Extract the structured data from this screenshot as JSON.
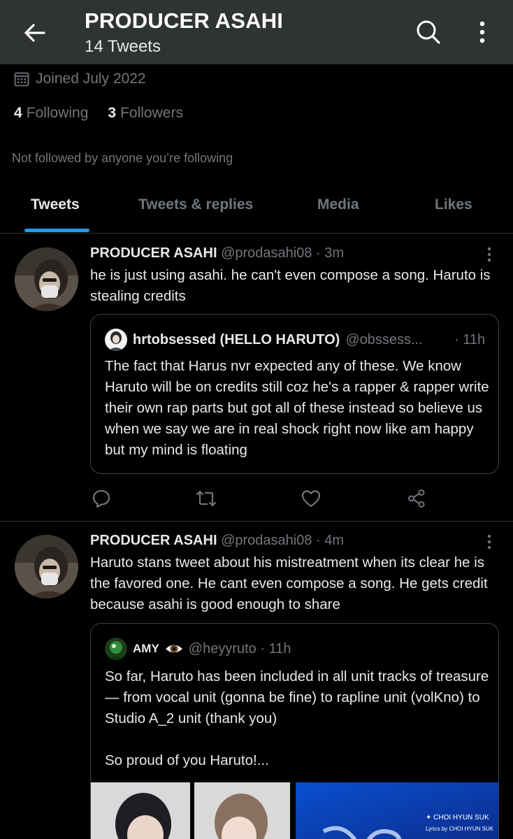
{
  "header": {
    "title": "PRODUCER ASAHI",
    "subtitle": "14 Tweets"
  },
  "profile": {
    "joined": "Joined July 2022",
    "following_count": "4",
    "following_label": "Following",
    "followers_count": "3",
    "followers_label": "Followers",
    "not_followed": "Not followed by anyone you’re following"
  },
  "tabs": [
    {
      "label": "Tweets",
      "active": true
    },
    {
      "label": "Tweets & replies",
      "active": false
    },
    {
      "label": "Media",
      "active": false
    },
    {
      "label": "Likes",
      "active": false
    }
  ],
  "tweets": [
    {
      "name": "PRODUCER ASAHI",
      "meta": "@prodasahi08 · 3m",
      "text": "he is just using asahi. he can't even compose a song. Haruto is stealing credits",
      "quote": {
        "name": "hrtobsessed (HELLO HARUTO)",
        "meta": "@obssess...",
        "time": "· 11h",
        "text": "The fact that Harus nvr expected any of these. We know Haruto will be on credits still coz he's a rapper & rapper write their own rap parts but got all of these instead so believe us when we say we are in real shock right now like am happy but my mind is floating"
      }
    },
    {
      "name": "PRODUCER ASAHI",
      "meta": "@prodasahi08 · 4m",
      "text": "Haruto stans tweet about his mistreatment when its clear he is the favored one. He cant even compose a song. He gets credit because asahi is good enough to share",
      "quote": {
        "name": "AMY",
        "meta": "@heyyruto · 11h",
        "text": "So far, Haruto has been included in all unit tracks of treasure — from vocal unit (gonna be fine) to rapline unit (volKno) to Studio A_2 unit (thank you)\n\nSo proud of you Haruto!...",
        "media_caption_1": "✦ CHOI HYUN SUK",
        "media_caption_2": "Lyrics by CHOI HYUN SUK"
      }
    }
  ],
  "icons": {
    "back": "arrow-left-icon",
    "search": "search-icon",
    "more": "more-vertical-icon",
    "calendar": "calendar-icon",
    "reply": "reply-icon",
    "retweet": "retweet-icon",
    "like": "heart-icon",
    "share": "share-icon"
  },
  "colors": {
    "accent": "#1d9bf0",
    "header_bg": "#2f3432",
    "secondary_text": "#71767b"
  }
}
